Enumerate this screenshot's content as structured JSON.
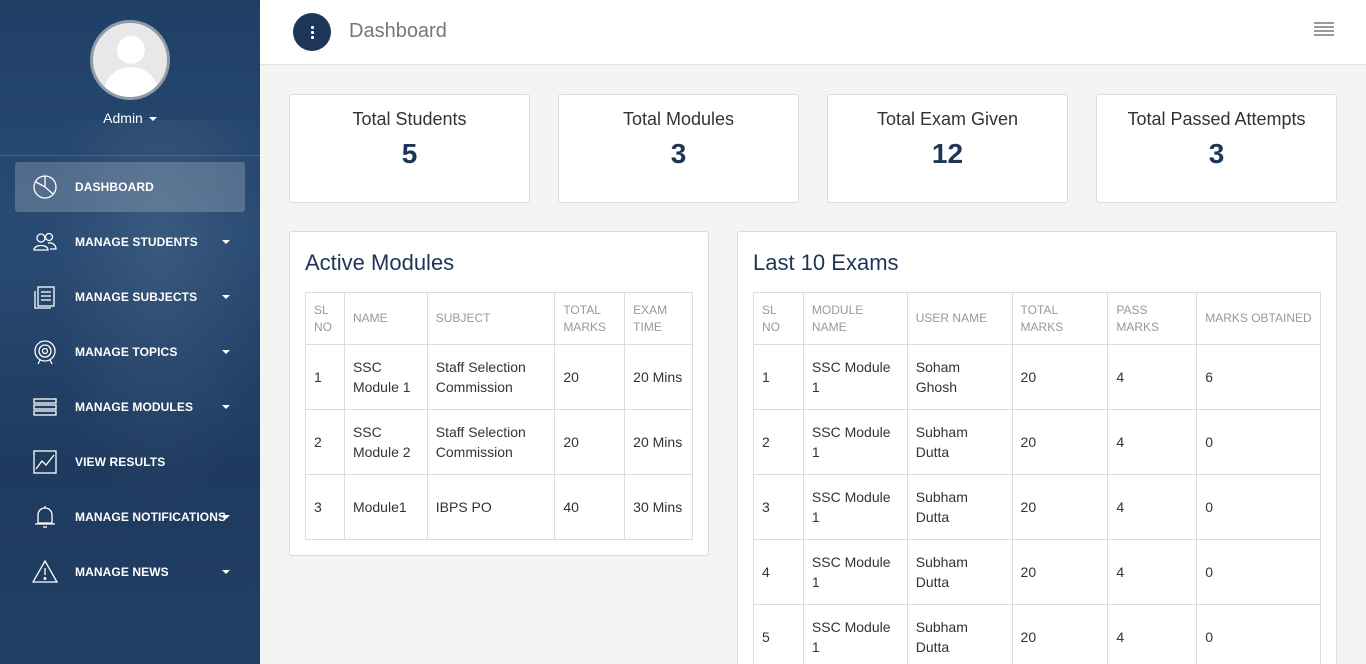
{
  "sidebar": {
    "user": "Admin",
    "items": [
      {
        "label": "DASHBOARD",
        "icon": "pie-chart-icon",
        "active": true,
        "caret": false
      },
      {
        "label": "MANAGE STUDENTS",
        "icon": "users-icon",
        "active": false,
        "caret": true
      },
      {
        "label": "MANAGE SUBJECTS",
        "icon": "document-icon",
        "active": false,
        "caret": true
      },
      {
        "label": "MANAGE TOPICS",
        "icon": "target-icon",
        "active": false,
        "caret": true
      },
      {
        "label": "MANAGE MODULES",
        "icon": "layers-icon",
        "active": false,
        "caret": true
      },
      {
        "label": "VIEW RESULTS",
        "icon": "line-chart-icon",
        "active": false,
        "caret": false
      },
      {
        "label": "MANAGE NOTIFICATIONS",
        "icon": "bell-icon",
        "active": false,
        "caret": true
      },
      {
        "label": "MANAGE NEWS",
        "icon": "warning-icon",
        "active": false,
        "caret": true
      }
    ]
  },
  "header": {
    "title": "Dashboard"
  },
  "stats": [
    {
      "label": "Total Students",
      "value": "5"
    },
    {
      "label": "Total Modules",
      "value": "3"
    },
    {
      "label": "Total Exam Given",
      "value": "12"
    },
    {
      "label": "Total Passed Attempts",
      "value": "3"
    }
  ],
  "active_modules": {
    "title": "Active Modules",
    "headers": [
      "SL NO",
      "NAME",
      "SUBJECT",
      "TOTAL MARKS",
      "EXAM TIME"
    ],
    "rows": [
      [
        "1",
        "SSC Module 1",
        "Staff Selection Commission",
        "20",
        "20 Mins"
      ],
      [
        "2",
        "SSC Module 2",
        "Staff Selection Commission",
        "20",
        "20 Mins"
      ],
      [
        "3",
        "Module1",
        "IBPS PO",
        "40",
        "30 Mins"
      ]
    ]
  },
  "last_exams": {
    "title": "Last 10 Exams",
    "headers": [
      "SL NO",
      "MODULE NAME",
      "USER NAME",
      "TOTAL MARKS",
      "PASS MARKS",
      "MARKS OBTAINED"
    ],
    "rows": [
      [
        "1",
        "SSC Module 1",
        "Soham Ghosh",
        "20",
        "4",
        "6"
      ],
      [
        "2",
        "SSC Module 1",
        "Subham Dutta",
        "20",
        "4",
        "0"
      ],
      [
        "3",
        "SSC Module 1",
        "Subham Dutta",
        "20",
        "4",
        "0"
      ],
      [
        "4",
        "SSC Module 1",
        "Subham Dutta",
        "20",
        "4",
        "0"
      ],
      [
        "5",
        "SSC Module 1",
        "Subham Dutta",
        "20",
        "4",
        "0"
      ]
    ]
  },
  "colors": {
    "accent": "#1d3557",
    "sidebar": "#1f3f66"
  }
}
